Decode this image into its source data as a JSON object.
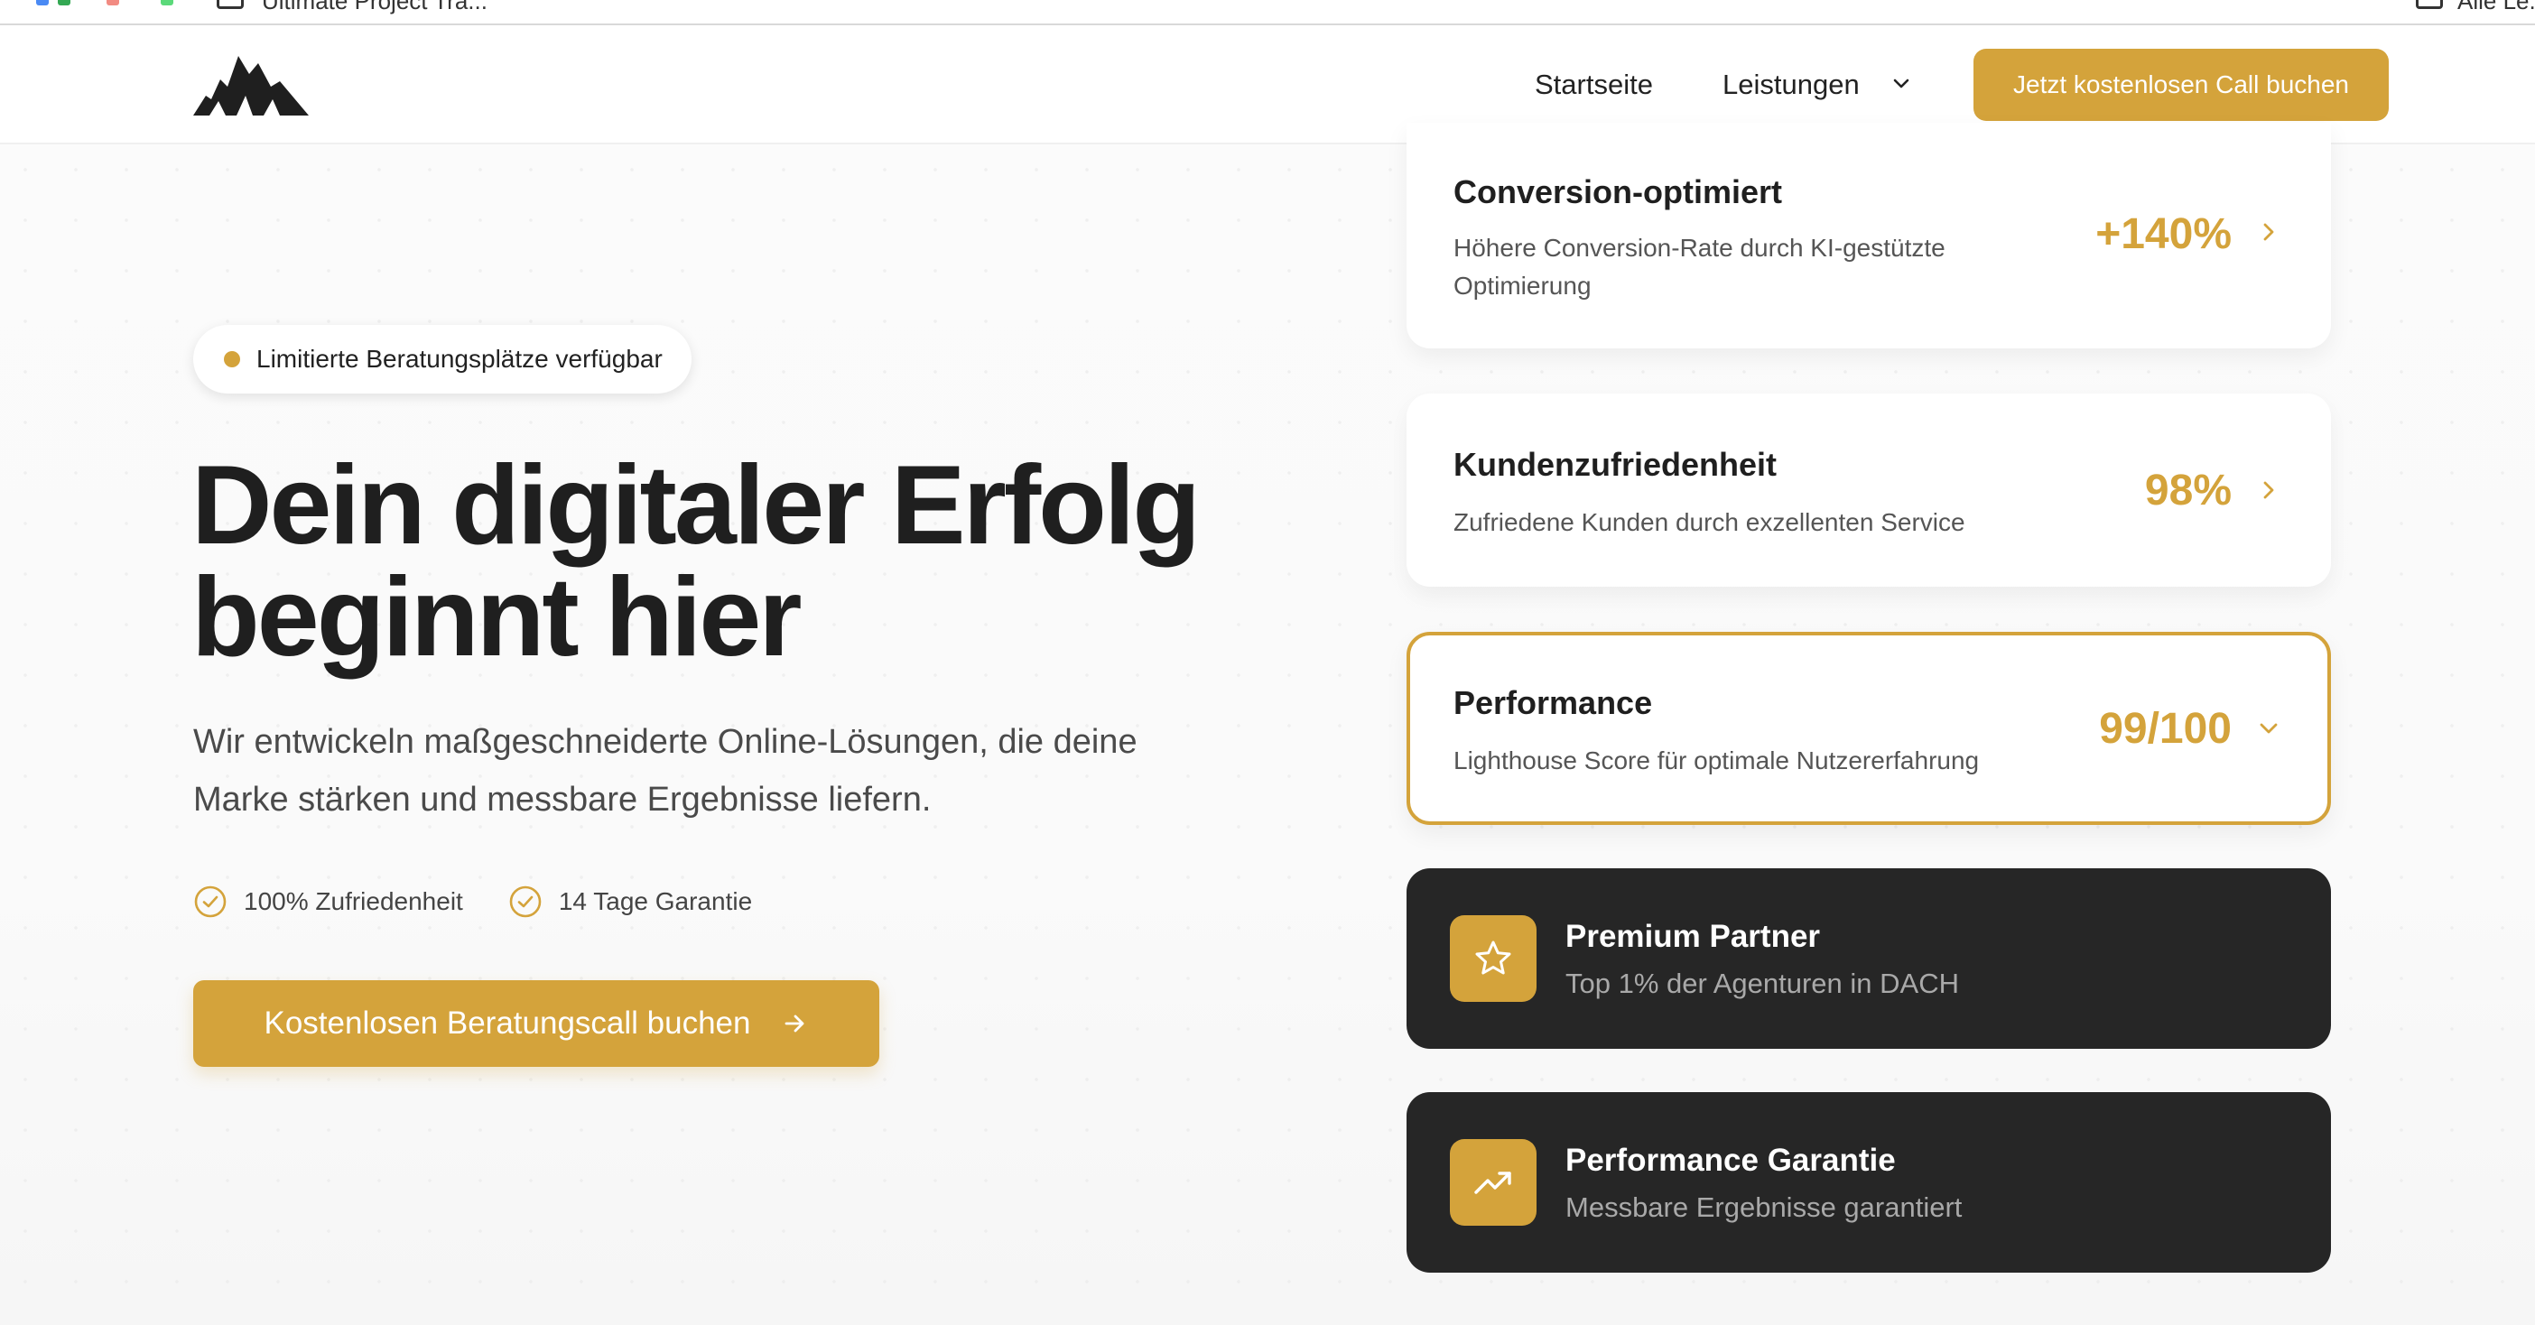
{
  "browser": {
    "tab_title": "Ultimate Project Tra...",
    "right_tab_title": "Alle Le..."
  },
  "header": {
    "logo": "mountain-logo",
    "nav": {
      "home": "Startseite",
      "services": "Leistungen"
    },
    "cta": "Jetzt kostenlosen Call buchen"
  },
  "hero": {
    "badge": "Limitierte Beratungsplätze verfügbar",
    "title_line1": "Dein digitaler Erfolg",
    "title_line2": "beginnt hier",
    "subtitle": "Wir entwickeln maßgeschneiderte Online-Lösungen, die deine Marke stärken und messbare Ergebnisse liefern.",
    "checks": [
      "100% Zufriedenheit",
      "14 Tage Garantie"
    ],
    "cta": "Kostenlosen Beratungscall buchen"
  },
  "stats": [
    {
      "title": "Conversion-optimiert",
      "description": "Höhere Conversion-Rate durch KI-gestützte Optimierung",
      "value": "+140%",
      "icon": "chevron-right-icon"
    },
    {
      "title": "Kundenzufriedenheit",
      "description": "Zufriedene Kunden durch exzellenten Service",
      "value": "98%",
      "icon": "chevron-right-icon"
    },
    {
      "title": "Performance",
      "description": "Lighthouse Score für optimale Nutzererfahrung",
      "value": "99/100",
      "icon": "chevron-down-icon",
      "active": true
    }
  ],
  "highlights": [
    {
      "title": "Premium Partner",
      "description": "Top 1% der Agenturen in DACH",
      "icon": "star-icon"
    },
    {
      "title": "Performance Garantie",
      "description": "Messbare Ergebnisse garantiert",
      "icon": "trending-up-icon"
    }
  ],
  "colors": {
    "accent": "#d4a33b",
    "dark_card": "#262626",
    "text": "#1f1f1f"
  }
}
